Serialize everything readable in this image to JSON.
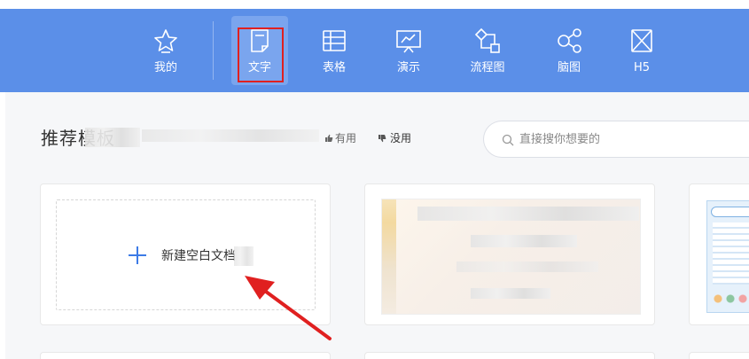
{
  "nav": {
    "items": [
      {
        "key": "mine",
        "label": "我的",
        "icon": "star-icon"
      },
      {
        "key": "text",
        "label": "文字",
        "icon": "document-icon",
        "active": true
      },
      {
        "key": "sheet",
        "label": "表格",
        "icon": "table-icon"
      },
      {
        "key": "slides",
        "label": "演示",
        "icon": "presentation-icon"
      },
      {
        "key": "flow",
        "label": "流程图",
        "icon": "flowchart-icon"
      },
      {
        "key": "mind",
        "label": "脑图",
        "icon": "mindmap-icon"
      },
      {
        "key": "h5",
        "label": "H5",
        "icon": "h5-icon"
      }
    ]
  },
  "templates": {
    "title": "推荐模板",
    "feedback_yes": "有用",
    "feedback_no": "没用"
  },
  "search": {
    "placeholder": "直接搜你想要的"
  },
  "new_doc": {
    "label": "新建空白文档"
  },
  "colors": {
    "topbar": "#5b8fe8",
    "active_tab_bg": "#7aa5ee",
    "highlight_box": "#e02020",
    "accent_blue": "#3d7be6",
    "annotation_arrow": "#e02020"
  }
}
